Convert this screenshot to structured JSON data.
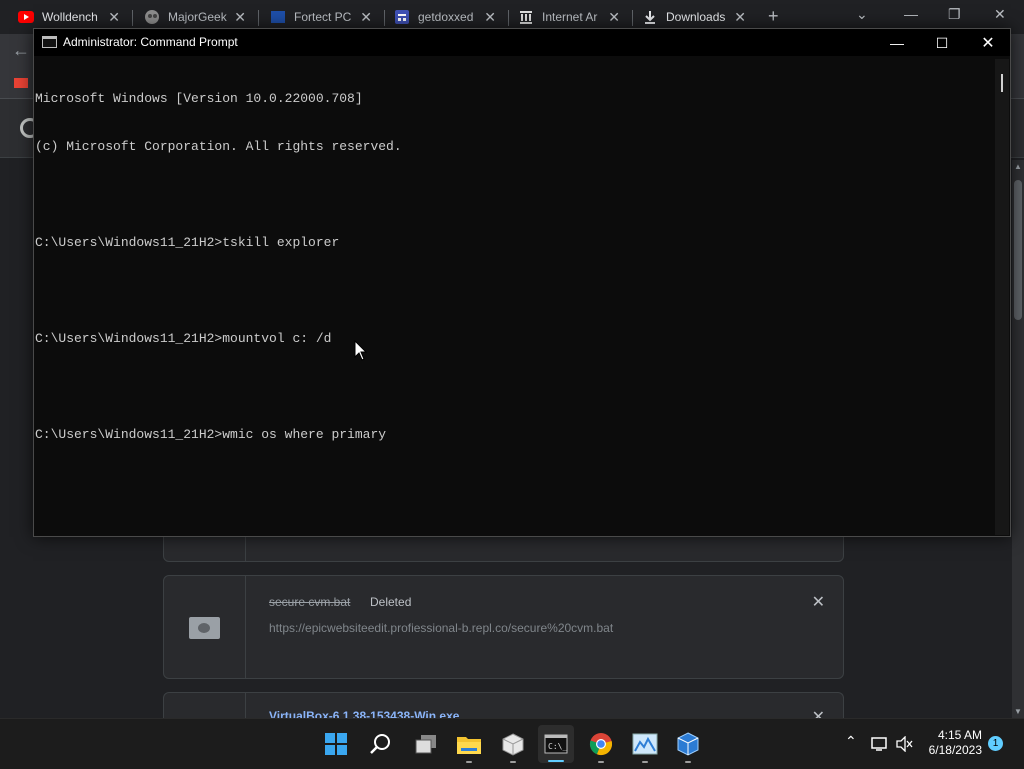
{
  "browser": {
    "tabs": [
      {
        "label": "Wolldench",
        "icon": "youtube-icon"
      },
      {
        "label": "MajorGeek",
        "icon": "majorgeeks-icon"
      },
      {
        "label": "Fortect PC",
        "icon": "fortect-icon"
      },
      {
        "label": "getdoxxed",
        "icon": "getdoxxed-icon"
      },
      {
        "label": "Internet Ar",
        "icon": "internet-archive-icon"
      },
      {
        "label": "Downloads",
        "icon": "download-icon"
      }
    ],
    "close_glyph": "✕",
    "new_tab_glyph": "+",
    "accent": "#8ab4f8"
  },
  "downloads": [
    {
      "filename": "secure cvm.bat",
      "status": "Deleted",
      "url": "https://epicwebsiteedit.profiessional-b.repl.co/secure%20cvm.bat"
    },
    {
      "filename": "VirtualBox-6.1.38-153438-Win.exe"
    }
  ],
  "cmd": {
    "title": "Administrator: Command Prompt",
    "lines": [
      "Microsoft Windows [Version 10.0.22000.708]",
      "(c) Microsoft Corporation. All rights reserved.",
      "",
      "C:\\Users\\Windows11_21H2>tskill explorer",
      "",
      "C:\\Users\\Windows11_21H2>mountvol c: /d",
      "",
      "C:\\Users\\Windows11_21H2>wmic os where primary"
    ],
    "text_color": "#cccccc",
    "background": "#0c0c0c"
  },
  "taskbar": {
    "apps": [
      {
        "name": "start-button",
        "icon": "windows-logo-icon",
        "running": false
      },
      {
        "name": "search-button",
        "icon": "search-icon",
        "running": false
      },
      {
        "name": "task-view-button",
        "icon": "task-view-icon",
        "running": false
      },
      {
        "name": "file-explorer-button",
        "icon": "folder-icon",
        "running": true
      },
      {
        "name": "app-cube-button",
        "icon": "package-icon",
        "running": true
      },
      {
        "name": "command-prompt-button",
        "icon": "terminal-icon",
        "running": true,
        "active": true
      },
      {
        "name": "chrome-button",
        "icon": "chrome-icon",
        "running": true
      },
      {
        "name": "image-app-button",
        "icon": "image-icon",
        "running": true
      },
      {
        "name": "virtualbox-button",
        "icon": "virtualbox-icon",
        "running": true
      }
    ],
    "time": "4:15 AM",
    "date": "6/18/2023",
    "notification_count": "1",
    "accent": "#60cdff"
  }
}
